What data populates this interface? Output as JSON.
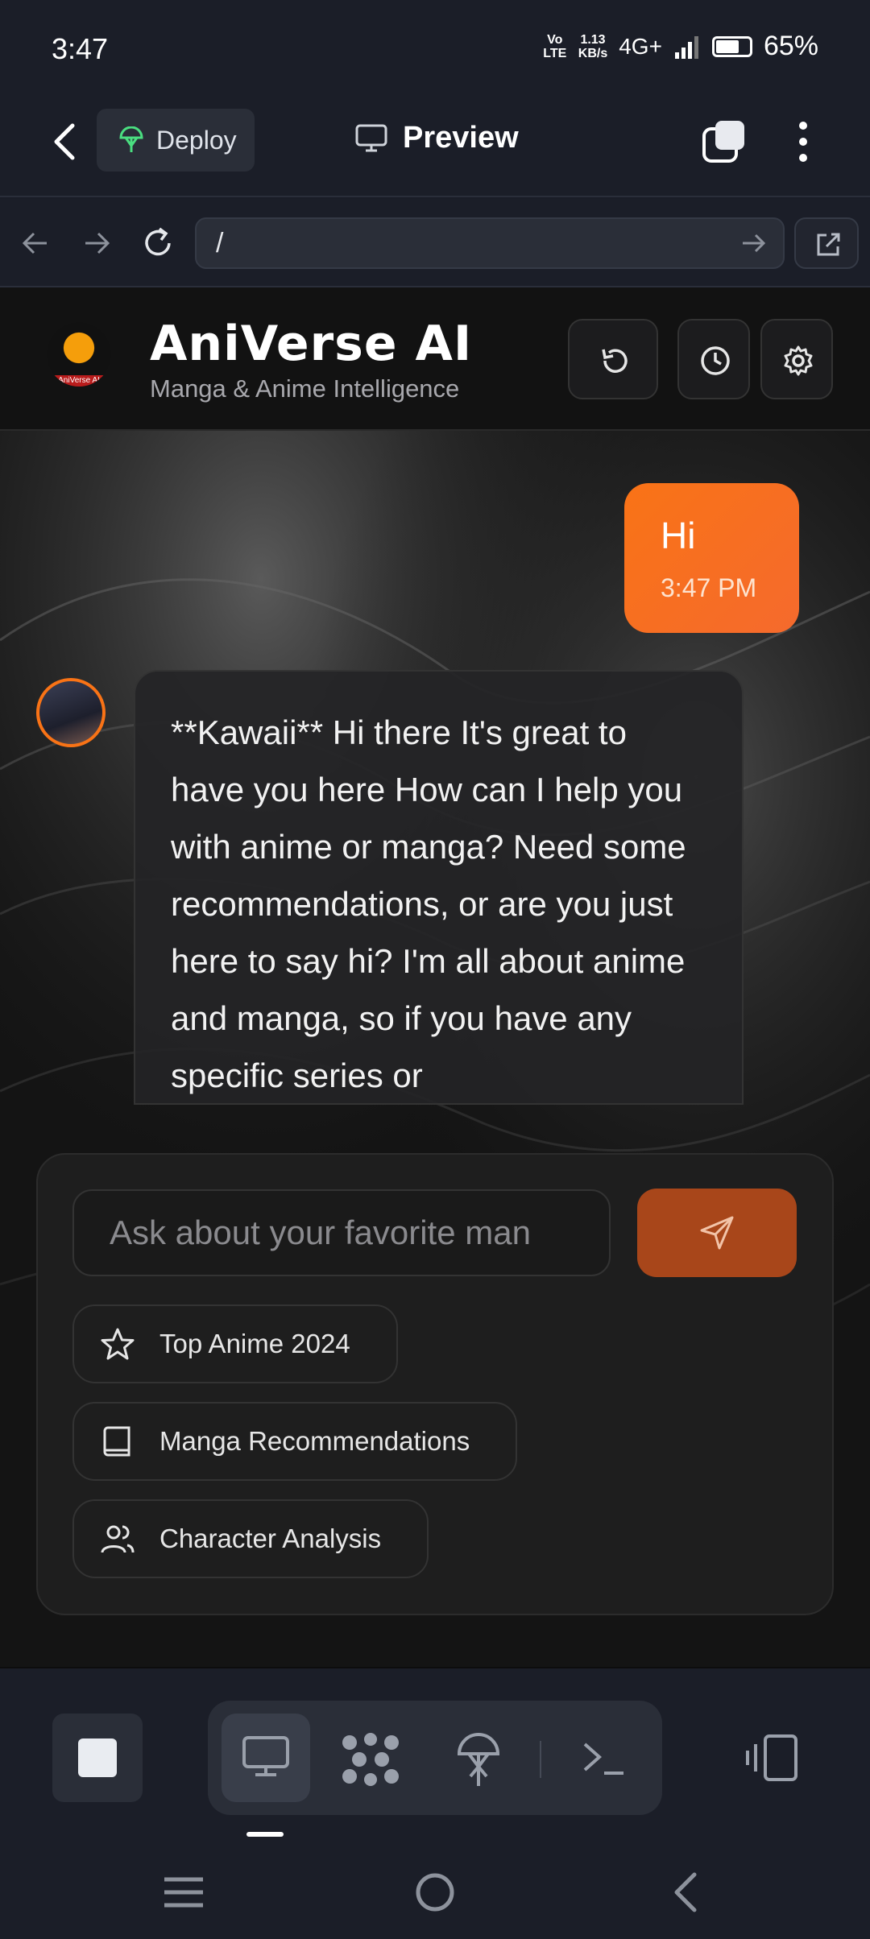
{
  "status_bar": {
    "time": "3:47",
    "network_top": "1.13",
    "network_bottom": "KB/s",
    "signal_label": "4G+",
    "volte": "Vo LTE",
    "battery": "65%"
  },
  "app_header": {
    "deploy_label": "Deploy",
    "preview_label": "Preview"
  },
  "browser": {
    "url": "/"
  },
  "site": {
    "brand": "AniVerse AI",
    "tagline": "Manga & Anime Intelligence",
    "logo_text": "AniVerse AI"
  },
  "messages": [
    {
      "role": "user",
      "text": "Hi",
      "time": "3:47 PM"
    },
    {
      "role": "assistant",
      "text": "**Kawaii** Hi there It's great to have you here How can I help you with anime or manga? Need some recommendations, or are you just here to say hi? I'm all about anime and manga, so if you have any specific series or"
    }
  ],
  "composer": {
    "placeholder": "Ask about your favorite man",
    "suggestions": [
      {
        "label": "Top Anime 2024",
        "icon": "star-icon"
      },
      {
        "label": "Manga Recommendations",
        "icon": "book-icon"
      },
      {
        "label": "Character Analysis",
        "icon": "users-icon"
      }
    ]
  },
  "colors": {
    "accent": "#f97316",
    "send_button": "#a8461a",
    "app_chrome": "#1b1e28"
  }
}
